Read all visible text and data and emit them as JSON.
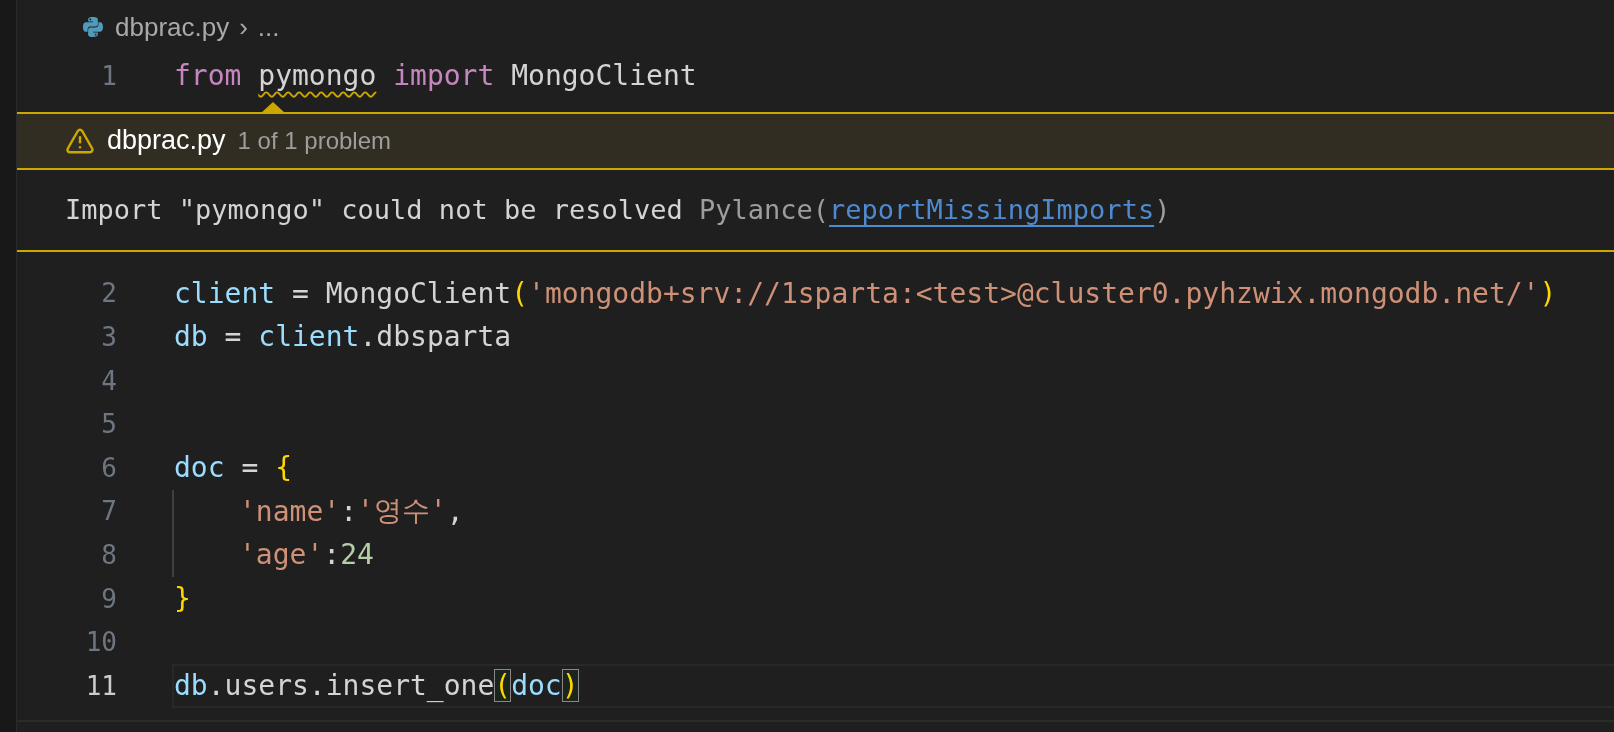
{
  "breadcrumb": {
    "file": "dbprac.py",
    "separator": "›",
    "rest": "..."
  },
  "lines_before": [
    {
      "number": "1",
      "current": false,
      "tokens": [
        {
          "kind": "keyword",
          "text": "from "
        },
        {
          "kind": "module",
          "text": "pymongo",
          "squiggly": true
        },
        {
          "kind": "keyword",
          "text": " import"
        },
        {
          "kind": "plain",
          "text": " MongoClient"
        }
      ]
    }
  ],
  "problem": {
    "file": "dbprac.py",
    "summary": "1 of 1 problem",
    "message": "Import \"pymongo\" could not be resolved",
    "source": "Pylance(",
    "code": "reportMissingImports",
    "close": ")"
  },
  "lines_after": [
    {
      "number": "2",
      "current": false,
      "tokens": [
        {
          "kind": "variable",
          "text": "client"
        },
        {
          "kind": "plain",
          "text": " = MongoClient"
        },
        {
          "kind": "bracket",
          "text": "("
        },
        {
          "kind": "string",
          "text": "'mongodb+srv://1sparta:<test>@cluster0.pyhzwix.mongodb.net/'"
        },
        {
          "kind": "bracket",
          "text": ")"
        }
      ]
    },
    {
      "number": "3",
      "current": false,
      "tokens": [
        {
          "kind": "variable",
          "text": "db"
        },
        {
          "kind": "plain",
          "text": " = "
        },
        {
          "kind": "variable",
          "text": "client"
        },
        {
          "kind": "plain",
          "text": ".dbsparta"
        }
      ]
    },
    {
      "number": "4",
      "current": false
    },
    {
      "number": "5",
      "current": false
    },
    {
      "number": "6",
      "current": false,
      "tokens": [
        {
          "kind": "variable",
          "text": "doc"
        },
        {
          "kind": "plain",
          "text": " = "
        },
        {
          "kind": "bracket",
          "text": "{"
        }
      ]
    },
    {
      "number": "7",
      "current": false,
      "indented": true,
      "tokens": [
        {
          "kind": "string",
          "text": "'name'"
        },
        {
          "kind": "plain",
          "text": ":"
        },
        {
          "kind": "string",
          "text": "'영수'"
        },
        {
          "kind": "plain",
          "text": ","
        }
      ]
    },
    {
      "number": "8",
      "current": false,
      "indented": true,
      "tokens": [
        {
          "kind": "string",
          "text": "'age'"
        },
        {
          "kind": "plain",
          "text": ":"
        },
        {
          "kind": "number",
          "text": "24"
        }
      ]
    },
    {
      "number": "9",
      "current": false,
      "tokens": [
        {
          "kind": "bracket",
          "text": "}"
        }
      ]
    },
    {
      "number": "10",
      "current": false
    },
    {
      "number": "11",
      "current": true,
      "tokens": [
        {
          "kind": "variable",
          "text": "db"
        },
        {
          "kind": "plain",
          "text": ".users.insert_one"
        },
        {
          "kind": "bracket",
          "text": "(",
          "matched": true
        },
        {
          "kind": "variable",
          "text": "doc"
        },
        {
          "kind": "bracket",
          "text": ")",
          "matched": true
        }
      ]
    }
  ]
}
